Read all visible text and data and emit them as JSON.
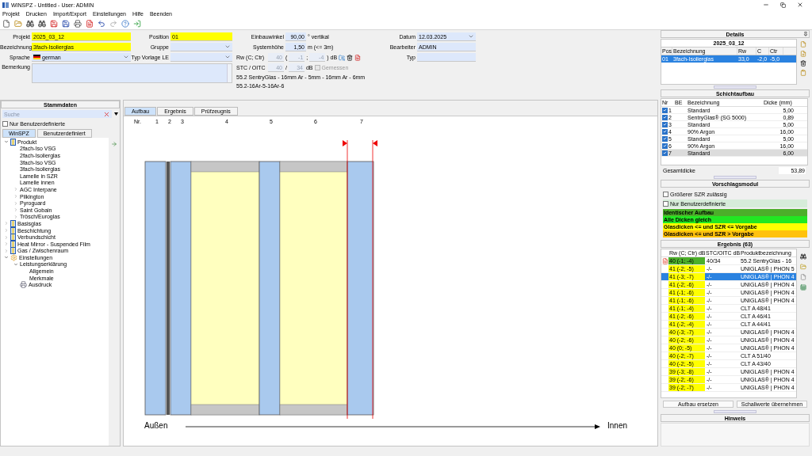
{
  "window": {
    "title": "WINSPZ - Untitled - User: ADMIN"
  },
  "menu": [
    "Projekt",
    "Drucken",
    "Import/Export",
    "Einstellungen",
    "Hilfe",
    "Beenden"
  ],
  "form": {
    "projekt": {
      "label": "Projekt",
      "value": "2025_03_12",
      "highlighted": true
    },
    "bezeichnung": {
      "label": "Bezeichnung",
      "value": "3fach-Isolierglas",
      "highlighted": true
    },
    "sprache": {
      "label": "Sprache",
      "value": "german"
    },
    "bemerkung": {
      "label": "Bemerkung"
    },
    "position": {
      "label": "Position",
      "value": "01",
      "highlighted": true
    },
    "gruppe": {
      "label": "Gruppe"
    },
    "typ_vorlage": {
      "label": "Typ Vorlage LE"
    },
    "einbauwinkel": {
      "label": "Einbauwinkel",
      "value": "90,00",
      "unit": "° vertikal"
    },
    "systemhoehe": {
      "label": "Systemhöhe",
      "value": "1,50",
      "unit": "m (<= 3m)"
    },
    "rw": {
      "label": "Rw (C; Ctr)",
      "value": "40",
      "open": "(",
      "c": "-1",
      "sep": ";",
      "ctr": "-4",
      "unit": ") dB",
      "disabled": true
    },
    "stc": {
      "label": "STC / OITC",
      "value": "40",
      "sep": "/",
      "oitc": "34",
      "unit": "dB",
      "disabled": true
    },
    "gemessen": {
      "label": "Gemessen",
      "checked": false,
      "disabled": true
    },
    "summary": [
      "55.2 SentryGlas - 16mm Ar - 5mm - 16mm Ar - 6mm",
      "55.2-16Ar-5-16Ar-6"
    ],
    "datum": {
      "label": "Datum",
      "value": "12.03.2025"
    },
    "bearbeiter": {
      "label": "Bearbeiter",
      "value": "ADMIN"
    },
    "typ": {
      "label": "Typ"
    }
  },
  "stammdaten": {
    "title": "Stammdaten",
    "search": {
      "placeholder": "Suche"
    },
    "nur_benutzer": {
      "label": "Nur Benutzerdefinierte",
      "checked": false
    },
    "tabs": [
      {
        "label": "WinSPZ",
        "selected": true
      },
      {
        "label": "Benutzerdefiniert",
        "selected": false
      }
    ],
    "tree": [
      {
        "label": "Produkt",
        "kind": "glass",
        "expanded": true,
        "children": [
          {
            "label": "2fach-Iso VSG",
            "kind": "entry",
            "expanded": false
          },
          {
            "label": "2fach-Isolierglas",
            "kind": "entry",
            "expanded": false
          },
          {
            "label": "3fach-Iso VSG",
            "kind": "entry",
            "expanded": false
          },
          {
            "label": "3fach-Isolierglas",
            "kind": "entry",
            "expanded": false
          },
          {
            "label": "Lamelle in SZR",
            "kind": "entry",
            "expanded": false
          },
          {
            "label": "Lamelle innen",
            "kind": "entry",
            "expanded": false
          },
          {
            "label": "AGC Interpane",
            "kind": "folder",
            "expanded": false
          },
          {
            "label": "Pilkington",
            "kind": "folder",
            "expanded": false
          },
          {
            "label": "Pyroguard",
            "kind": "folder",
            "expanded": false
          },
          {
            "label": "Saint Gobain",
            "kind": "folder",
            "expanded": false
          },
          {
            "label": "Trösch/Euroglas",
            "kind": "folder",
            "expanded": false
          }
        ]
      },
      {
        "label": "Basisglas",
        "kind": "glass",
        "expanded": false
      },
      {
        "label": "Beschichtung",
        "kind": "glass",
        "expanded": false
      },
      {
        "label": "Verbundschicht",
        "kind": "glass",
        "expanded": false
      },
      {
        "label": "Heat Mirror - Suspended Film",
        "kind": "glass",
        "expanded": false
      },
      {
        "label": "Gas / Zwischenraum",
        "kind": "glass",
        "expanded": false
      },
      {
        "label": "Einstellungen",
        "kind": "settings",
        "expanded": true,
        "children": [
          {
            "label": "Leistungserklärung",
            "kind": "folder",
            "expanded": true,
            "children": [
              {
                "label": "Allgemein",
                "kind": "entry",
                "expanded": false
              },
              {
                "label": "Merkmale",
                "kind": "entry",
                "expanded": false
              }
            ]
          },
          {
            "label": "Ausdruck",
            "kind": "printer",
            "expanded": false
          }
        ]
      }
    ]
  },
  "center": {
    "tabs": [
      {
        "label": "Aufbau",
        "selected": true
      },
      {
        "label": "Ergebnis",
        "selected": false
      },
      {
        "label": "Prüfzeugnis",
        "selected": false
      }
    ],
    "columns": [
      "Nr.",
      "1",
      "2",
      "3",
      "4",
      "5",
      "6",
      "7"
    ],
    "outside": "Außen",
    "inside": "Innen"
  },
  "details": {
    "title": "Details",
    "project": "2025_03_12",
    "columns": [
      "Pos",
      "Bezeichnung",
      "Rw",
      "C",
      "Ctr"
    ],
    "rows": [
      {
        "cells": [
          "01",
          "3fach-Isolierglas",
          "33,0",
          "-2,0",
          "-5,0"
        ],
        "selected": true
      }
    ]
  },
  "schichtaufbau": {
    "title": "Schichtaufbau",
    "columns": [
      "Nr",
      "BE",
      "Bezeichnung",
      "Dicke (mm)"
    ],
    "rows": [
      {
        "nr": "1",
        "name": "Standard",
        "dicke": "5,00",
        "checked": true,
        "selected": false
      },
      {
        "nr": "2",
        "name": "SentryGlas® (SG 5000)",
        "dicke": "0,89",
        "checked": true,
        "selected": false
      },
      {
        "nr": "3",
        "name": "Standard",
        "dicke": "5,00",
        "checked": true,
        "selected": false
      },
      {
        "nr": "4",
        "name": "90% Argon",
        "dicke": "16,00",
        "checked": true,
        "selected": false
      },
      {
        "nr": "5",
        "name": "Standard",
        "dicke": "5,00",
        "checked": true,
        "selected": false
      },
      {
        "nr": "6",
        "name": "90% Argon",
        "dicke": "16,00",
        "checked": true,
        "selected": false
      },
      {
        "nr": "7",
        "name": "Standard",
        "dicke": "6,00",
        "checked": true,
        "selected": true
      }
    ],
    "total_label": "Gesamtdicke",
    "total": "53,89"
  },
  "vorschlag": {
    "title": "Vorschlagsmodul",
    "options": [
      {
        "label": "Größerer SZR zulässig",
        "checked": false
      },
      {
        "label": "Nur Benutzerdefinierte",
        "checked": false
      }
    ],
    "legend": [
      {
        "label": "Identischer Aufbau",
        "color": "#4caf2a"
      },
      {
        "label": "Alle Dicken gleich",
        "color": "#22e822"
      },
      {
        "label": "Glasdicken <= und SZR <= Vorgabe",
        "color": "#ffff00"
      },
      {
        "label": "Glasdicken <= und SZR > Vorgabe",
        "color": "#ffc20e"
      }
    ]
  },
  "ergebnis": {
    "title": "Ergebnis (63)",
    "columns": [
      "Rw (C; Ctr) dB",
      "STC/OITC dB",
      "Produktbezeichnung"
    ],
    "rows": [
      {
        "rw": "40 (-1; -4)",
        "stc": "40/34",
        "product": "55.2 SentryGlas - 16",
        "color": "#4caf2a",
        "report": true,
        "selected": false
      },
      {
        "rw": "41 (-2; -5)",
        "stc": "-/-",
        "product": "UNIGLAS® | PHON 5",
        "color": "#ffff00",
        "report": false,
        "selected": false
      },
      {
        "rw": "41 (-3; -7)",
        "stc": "-/-",
        "product": "UNIGLAS® | PHON 4",
        "color": "#ffff00",
        "report": false,
        "selected": true
      },
      {
        "rw": "41 (-2; -6)",
        "stc": "-/-",
        "product": "UNIGLAS® | PHON 4",
        "color": "#ffff00",
        "report": false,
        "selected": false
      },
      {
        "rw": "41 (-1; -6)",
        "stc": "-/-",
        "product": "UNIGLAS® | PHON 4",
        "color": "#ffff00",
        "report": false,
        "selected": false
      },
      {
        "rw": "41 (-1; -6)",
        "stc": "-/-",
        "product": "UNIGLAS® | PHON 4",
        "color": "#ffff00",
        "report": false,
        "selected": false
      },
      {
        "rw": "41 (-1; -4)",
        "stc": "-/-",
        "product": "CLT A 48/41",
        "color": "#ffff00",
        "report": false,
        "selected": false
      },
      {
        "rw": "41 (-2; -6)",
        "stc": "-/-",
        "product": "CLT A 46/41",
        "color": "#ffff00",
        "report": false,
        "selected": false
      },
      {
        "rw": "41 (-2; -4)",
        "stc": "-/-",
        "product": "CLT A 44/41",
        "color": "#ffff00",
        "report": false,
        "selected": false
      },
      {
        "rw": "40 (-3; -7)",
        "stc": "-/-",
        "product": "UNIGLAS® | PHON 4",
        "color": "#ffff00",
        "report": false,
        "selected": false
      },
      {
        "rw": "40 (-2; -6)",
        "stc": "-/-",
        "product": "UNIGLAS® | PHON 4",
        "color": "#ffff00",
        "report": false,
        "selected": false
      },
      {
        "rw": "40 (0; -5)",
        "stc": "-/-",
        "product": "UNIGLAS® | PHON 4",
        "color": "#ffff00",
        "report": false,
        "selected": false
      },
      {
        "rw": "40 (-2; -7)",
        "stc": "-/-",
        "product": "CLT A 51/40",
        "color": "#ffff00",
        "report": false,
        "selected": false
      },
      {
        "rw": "40 (-2; -5)",
        "stc": "-/-",
        "product": "CLT A 43/40",
        "color": "#ffff00",
        "report": false,
        "selected": false
      },
      {
        "rw": "39 (-3; -8)",
        "stc": "-/-",
        "product": "UNIGLAS® | PHON 4",
        "color": "#ffff00",
        "report": false,
        "selected": false
      },
      {
        "rw": "39 (-2; -6)",
        "stc": "-/-",
        "product": "UNIGLAS® | PHON 4",
        "color": "#ffff00",
        "report": false,
        "selected": false
      },
      {
        "rw": "39 (-2; -7)",
        "stc": "-/-",
        "product": "UNIGLAS® | PHON 4",
        "color": "#ffff00",
        "report": false,
        "selected": false
      }
    ],
    "buttons": [
      "Aufbau ersetzen",
      "Schallwerte übernehmen"
    ]
  },
  "hinweis": {
    "title": "Hinweis"
  }
}
